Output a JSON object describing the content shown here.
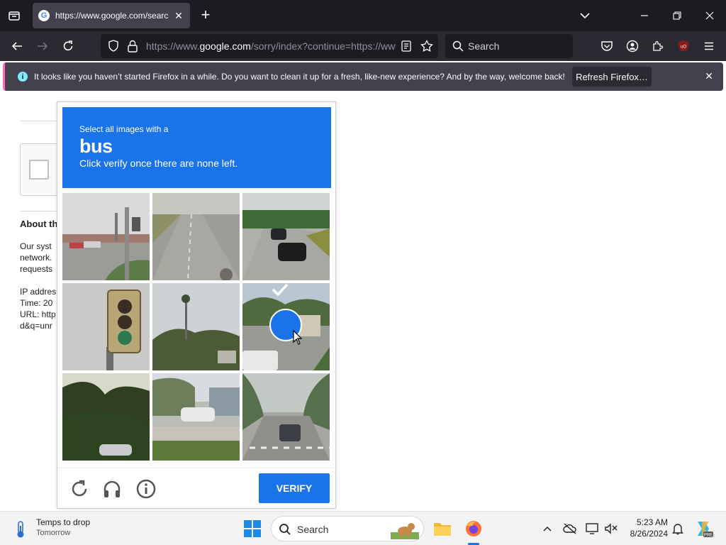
{
  "browser": {
    "tab_title": "https://www.google.com/search?q=unrelated",
    "favicon_letter": "G",
    "url_host_prefix": "https://www.",
    "url_host": "google.com",
    "url_path": "/sorry/index?continue=https://www.google.com/search",
    "search_placeholder": "Search"
  },
  "notification": {
    "text": "It looks like you haven’t started Firefox in a while. Do you want to clean it up for a fresh, like-new experience? And by the way, welcome back!",
    "button": "Refresh Firefox…"
  },
  "page": {
    "about_title": "About th",
    "lines": [
      "Our syst",
      "network.",
      "requests",
      "IP addres",
      "Time: 20",
      "URL: http",
      "d&q=unr"
    ]
  },
  "captcha": {
    "instruction_small": "Select all images with a",
    "target": "bus",
    "instruction_sub": "Click verify once there are none left.",
    "verify_label": "VERIFY",
    "selected_tiles": [
      5
    ],
    "tiles": [
      "traffic-light-intersection",
      "empty-highway",
      "cars-on-road",
      "traffic-light",
      "palm-trees-street",
      "suburban-street",
      "trees-sunset",
      "parked-car-palm",
      "street-with-car"
    ]
  },
  "taskbar": {
    "weather_title": "Temps to drop",
    "weather_sub": "Tomorrow",
    "search_label": "Search",
    "time": "5:23 AM",
    "date": "8/26/2024"
  },
  "colors": {
    "accent": "#1a73e8",
    "chrome_dark": "#1c1b22",
    "toolbar": "#2b2a33"
  }
}
